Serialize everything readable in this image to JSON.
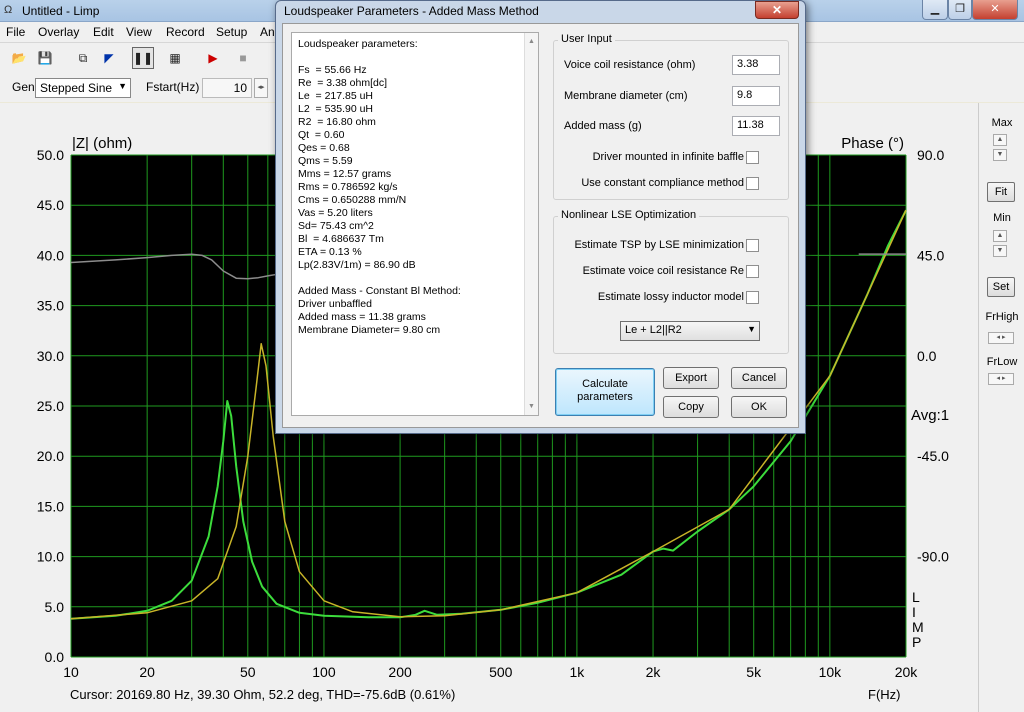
{
  "window": {
    "title": "Untitled - Limp",
    "app_icon": "ohm-icon"
  },
  "menu": [
    "File",
    "Overlay",
    "Edit",
    "View",
    "Record",
    "Setup",
    "An"
  ],
  "genbar": {
    "gen_label": "Gen",
    "gen_value": "Stepped Sine",
    "fstart_label": "Fstart(Hz)",
    "fstart_value": "10"
  },
  "right_panel": {
    "max_label": "Max",
    "fit_label": "Fit",
    "min_label": "Min",
    "set_label": "Set",
    "frhigh_label": "FrHigh",
    "frlow_label": "FrLow"
  },
  "plot": {
    "left_axis_title": "|Z| (ohm)",
    "right_axis_title": "Phase (°)",
    "avg_label": "Avg:1",
    "limp_letters": [
      "L",
      "I",
      "M",
      "P"
    ],
    "y_ticks": [
      "50.0",
      "45.0",
      "40.0",
      "35.0",
      "30.0",
      "25.0",
      "20.0",
      "15.0",
      "10.0",
      "5.0",
      "0.0"
    ],
    "phase_ticks": [
      "90.0",
      "45.0",
      "0.0",
      "-45.0",
      "-90.0"
    ],
    "x_ticks": [
      "10",
      "20",
      "50",
      "100",
      "200",
      "500",
      "1k",
      "2k",
      "5k",
      "10k",
      "20k"
    ],
    "cursor_text": "Cursor: 20169.80 Hz, 39.30 Ohm, 52.2 deg, THD=-75.6dB (0.61%)",
    "x_axis_title": "F(Hz)",
    "colors": {
      "background": "#000000",
      "grid": "#1f9a1f",
      "impedance_green": "#3cdc3c",
      "impedance_yellow": "#c8b428",
      "phase": "#8c8c8c"
    }
  },
  "chart_data": {
    "type": "line",
    "xscale": "log",
    "xlim": [
      10,
      20000
    ],
    "ylim": [
      0,
      50
    ],
    "phase_ylim": [
      -135,
      90
    ],
    "xlabel": "F(Hz)",
    "ylabel": "|Z| (ohm)",
    "y2label": "Phase (°)",
    "series": [
      {
        "key": "green",
        "color": "#3cdc3c",
        "axis": "left",
        "points": [
          [
            10,
            3.8
          ],
          [
            15,
            4.1
          ],
          [
            20,
            4.6
          ],
          [
            25,
            5.6
          ],
          [
            30,
            7.6
          ],
          [
            35,
            12
          ],
          [
            38,
            17
          ],
          [
            40,
            21.5
          ],
          [
            41.5,
            25.5
          ],
          [
            43,
            24
          ],
          [
            45,
            19
          ],
          [
            48,
            13.5
          ],
          [
            52,
            9.5
          ],
          [
            57,
            7
          ],
          [
            65,
            5.3
          ],
          [
            80,
            4.4
          ],
          [
            100,
            4.1
          ],
          [
            150,
            3.95
          ],
          [
            200,
            3.95
          ],
          [
            230,
            4.2
          ],
          [
            250,
            4.6
          ],
          [
            280,
            4.2
          ],
          [
            350,
            4.3
          ],
          [
            500,
            4.7
          ],
          [
            700,
            5.4
          ],
          [
            1000,
            6.4
          ],
          [
            1500,
            8.2
          ],
          [
            2000,
            10.5
          ],
          [
            2200,
            10.8
          ],
          [
            2400,
            10.6
          ],
          [
            3000,
            12.5
          ],
          [
            4000,
            14.7
          ],
          [
            5000,
            17
          ],
          [
            7000,
            21.5
          ],
          [
            10000,
            28
          ],
          [
            14000,
            36
          ],
          [
            17000,
            41
          ],
          [
            20000,
            44.5
          ]
        ]
      },
      {
        "key": "yellow",
        "color": "#c8b428",
        "axis": "left",
        "points": [
          [
            10,
            3.8
          ],
          [
            20,
            4.4
          ],
          [
            30,
            5.6
          ],
          [
            38,
            7.8
          ],
          [
            45,
            13
          ],
          [
            50,
            20
          ],
          [
            54,
            27
          ],
          [
            56.5,
            31.2
          ],
          [
            59,
            29
          ],
          [
            63,
            22
          ],
          [
            70,
            13.5
          ],
          [
            80,
            8.5
          ],
          [
            100,
            5.6
          ],
          [
            130,
            4.5
          ],
          [
            200,
            4
          ],
          [
            300,
            4.1
          ],
          [
            500,
            4.7
          ],
          [
            1000,
            6.4
          ],
          [
            2000,
            10.5
          ],
          [
            4000,
            14.7
          ],
          [
            10000,
            28
          ],
          [
            20000,
            44.5
          ]
        ]
      },
      {
        "key": "phase",
        "color": "#8c8c8c",
        "axis": "right",
        "points": [
          [
            10,
            41.8
          ],
          [
            15,
            43
          ],
          [
            20,
            44
          ],
          [
            25,
            45
          ],
          [
            30,
            45.5
          ],
          [
            33,
            45
          ],
          [
            36,
            43
          ],
          [
            40,
            38
          ],
          [
            45,
            34.8
          ],
          [
            50,
            34.5
          ],
          [
            55,
            35
          ],
          [
            60,
            35.8
          ],
          [
            65,
            36.5
          ]
        ]
      },
      {
        "key": "phase_high",
        "color": "#8c8c8c",
        "axis": "right",
        "points": [
          [
            13000,
            45.6
          ],
          [
            20000,
            45.6
          ]
        ]
      }
    ]
  },
  "dialog": {
    "title": "Loudspeaker Parameters - Added Mass Method",
    "close": "✕",
    "results_lines": [
      "Loudspeaker parameters:",
      "",
      "Fs  = 55.66 Hz",
      "Re  = 3.38 ohm[dc]",
      "Le  = 217.85 uH",
      "L2  = 535.90 uH",
      "R2  = 16.80 ohm",
      "Qt  = 0.60",
      "Qes = 0.68",
      "Qms = 5.59",
      "Mms = 12.57 grams",
      "Rms = 0.786592 kg/s",
      "Cms = 0.650288 mm/N",
      "Vas = 5.20 liters",
      "Sd= 75.43 cm^2",
      "Bl  = 4.686637 Tm",
      "ETA = 0.13 %",
      "Lp(2.83V/1m) = 86.90 dB",
      "",
      "Added Mass - Constant Bl Method:",
      "Driver unbaffled",
      "Added mass = 11.38 grams",
      "Membrane Diameter= 9.80 cm"
    ],
    "user_input": {
      "title": "User Input",
      "vc_label": "Voice coil resistance (ohm)",
      "vc_value": "3.38",
      "md_label": "Membrane diameter (cm)",
      "md_value": "9.8",
      "am_label": "Added mass (g)",
      "am_value": "11.38",
      "infinite_baffle_label": "Driver mounted in infinite baffle",
      "constant_compliance_label": "Use constant compliance method"
    },
    "nonlinear": {
      "title": "Nonlinear LSE Optimization",
      "tsp_label": "Estimate TSP by LSE minimization",
      "vcre_label": "Estimate voice coil resistance Re",
      "lossy_label": "Estimate lossy inductor model",
      "model_value": "Le + L2||R2"
    },
    "buttons": {
      "calc_line1": "Calculate",
      "calc_line2": "parameters",
      "export": "Export",
      "cancel": "Cancel",
      "copy": "Copy",
      "ok": "OK"
    }
  }
}
